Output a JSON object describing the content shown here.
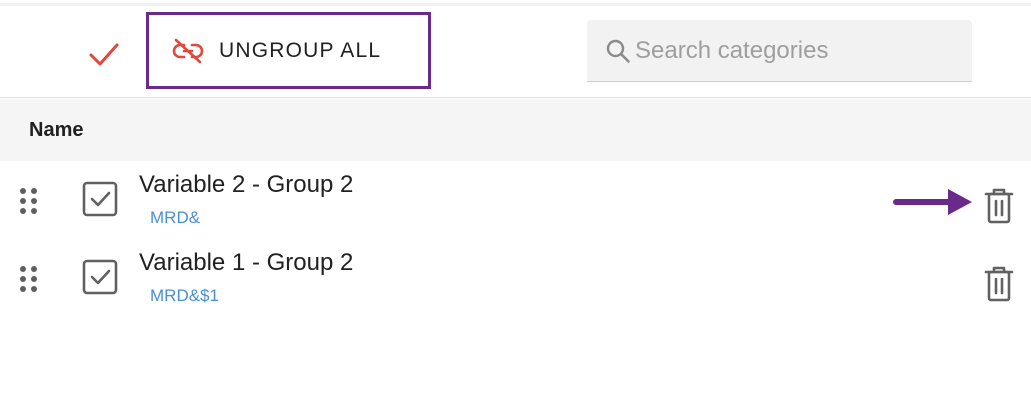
{
  "toolbar": {
    "check_icon": "check-icon",
    "ungroup_label": "UNGROUP ALL",
    "ungroup_icon": "link-off-icon",
    "search_placeholder": "Search categories",
    "search_value": ""
  },
  "table": {
    "column_name": "Name",
    "rows": [
      {
        "title": "Variable 2 - Group 2",
        "subtitle": "MRD&",
        "checked": true
      },
      {
        "title": "Variable 1 - Group 2",
        "subtitle": "MRD&$1",
        "checked": true
      }
    ]
  },
  "colors": {
    "accent_red": "#e0473d",
    "highlight_purple": "#6a2a8c",
    "subtitle_blue": "#4a8fd1"
  }
}
